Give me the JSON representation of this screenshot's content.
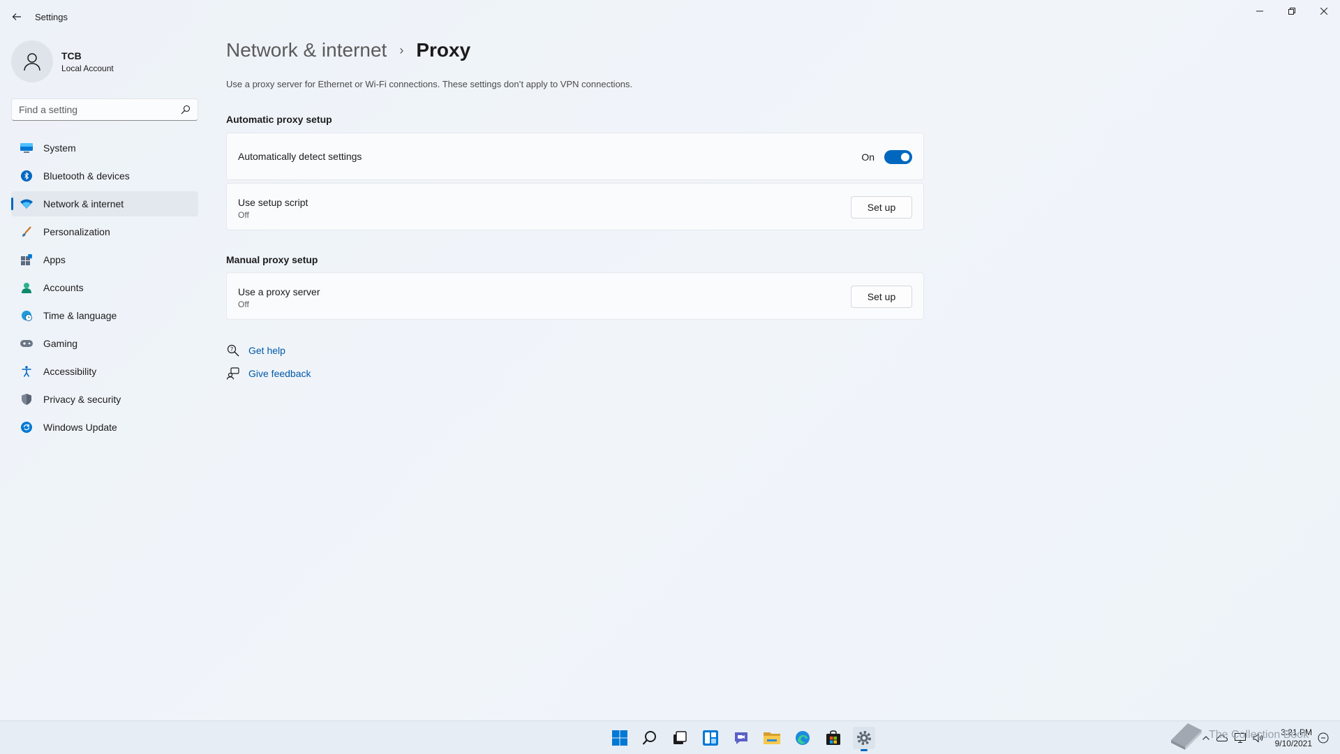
{
  "window": {
    "title": "Settings"
  },
  "profile": {
    "name": "TCB",
    "account_type": "Local Account"
  },
  "search": {
    "placeholder": "Find a setting"
  },
  "nav": {
    "items": [
      {
        "label": "System",
        "icon": "monitor-icon"
      },
      {
        "label": "Bluetooth & devices",
        "icon": "bluetooth-icon"
      },
      {
        "label": "Network & internet",
        "icon": "wifi-icon",
        "active": true
      },
      {
        "label": "Personalization",
        "icon": "brush-icon"
      },
      {
        "label": "Apps",
        "icon": "apps-icon"
      },
      {
        "label": "Accounts",
        "icon": "person-icon"
      },
      {
        "label": "Time & language",
        "icon": "globe-clock-icon"
      },
      {
        "label": "Gaming",
        "icon": "gamepad-icon"
      },
      {
        "label": "Accessibility",
        "icon": "accessibility-icon"
      },
      {
        "label": "Privacy & security",
        "icon": "shield-icon"
      },
      {
        "label": "Windows Update",
        "icon": "update-icon"
      }
    ]
  },
  "breadcrumb": {
    "parent": "Network & internet",
    "separator": "›",
    "current": "Proxy"
  },
  "description": "Use a proxy server for Ethernet or Wi-Fi connections. These settings don’t apply to VPN connections.",
  "automatic": {
    "section_title": "Automatic proxy setup",
    "detect": {
      "title": "Automatically detect settings",
      "toggle_label": "On",
      "toggle_on": true
    },
    "script": {
      "title": "Use setup script",
      "status": "Off",
      "button": "Set up"
    }
  },
  "manual": {
    "section_title": "Manual proxy setup",
    "proxy": {
      "title": "Use a proxy server",
      "status": "Off",
      "button": "Set up"
    }
  },
  "help": {
    "get_help": "Get help",
    "give_feedback": "Give feedback"
  },
  "taskbar": {
    "apps": [
      "start-icon",
      "search-icon",
      "task-view-icon",
      "widgets-icon",
      "chat-icon",
      "file-explorer-icon",
      "edge-icon",
      "store-icon",
      "settings-icon"
    ],
    "time": "3:21 PM",
    "date": "9/10/2021"
  },
  "watermark": "The Collection Book",
  "colors": {
    "accent": "#0067c0",
    "link": "#0058a8",
    "background": "#eef3f9"
  }
}
